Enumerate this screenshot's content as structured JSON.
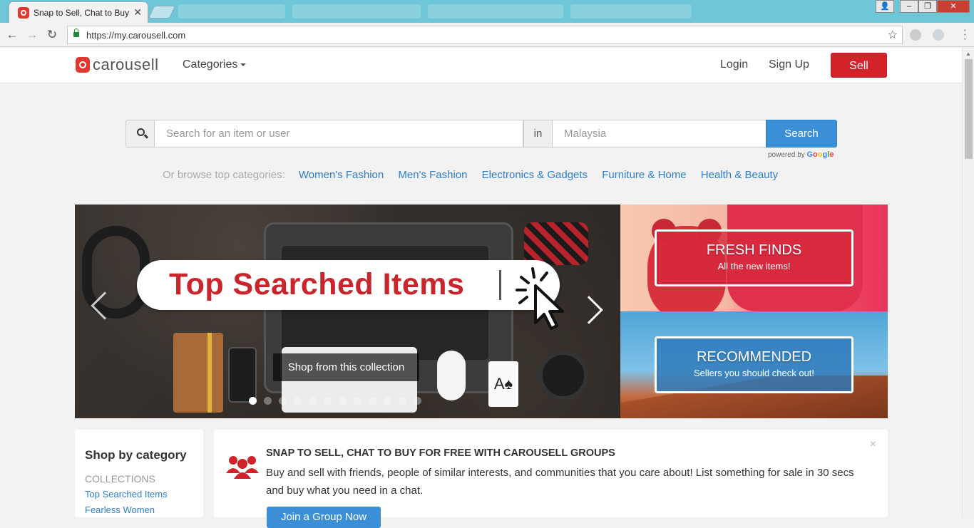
{
  "browser": {
    "active_tab_title": "Snap to Sell, Chat to Buy",
    "url": "https://my.carousell.com",
    "back_icon": "←",
    "forward_icon": "→",
    "reload_icon": "↻",
    "star_icon": "☆",
    "close_icon": "✕",
    "window_controls": [
      "–",
      "❐",
      "✕"
    ]
  },
  "header": {
    "logo_text": "carousell",
    "categories_label": "Categories",
    "login_label": "Login",
    "signup_label": "Sign Up",
    "sell_label": "Sell"
  },
  "search": {
    "query_placeholder": "Search for an item or user",
    "in_label": "in",
    "location_placeholder": "Malaysia",
    "button_label": "Search",
    "powered_by": "powered by"
  },
  "browse": {
    "label": "Or browse top categories:",
    "categories": [
      "Women's Fashion",
      "Men's Fashion",
      "Electronics & Gadgets",
      "Furniture & Home",
      "Health & Beauty"
    ]
  },
  "banner": {
    "headline": "Top Searched Items",
    "cta_label": "Shop from this collection",
    "slide_count": 12,
    "active_slide": 1,
    "card_glyph": "A♠"
  },
  "promos": [
    {
      "title": "FRESH FINDS",
      "subtitle": "All the new items!"
    },
    {
      "title": "RECOMMENDED",
      "subtitle": "Sellers you should check out!"
    }
  ],
  "shop_by_category": {
    "heading": "Shop by category",
    "section_label": "COLLECTIONS",
    "links": [
      "Top Searched Items",
      "Fearless Women"
    ]
  },
  "groups_card": {
    "title": "SNAP TO SELL, CHAT TO BUY FOR FREE WITH CAROUSELL GROUPS",
    "description": "Buy and sell with friends, people of similar interests, and communities that you care about! List something for sale in 30 secs and buy what you need in a chat.",
    "join_label": "Join a Group Now",
    "close_icon": "×"
  },
  "colors": {
    "brand_red": "#d2232a",
    "link_blue": "#2f7dc9",
    "search_blue": "#3b8fd7"
  }
}
